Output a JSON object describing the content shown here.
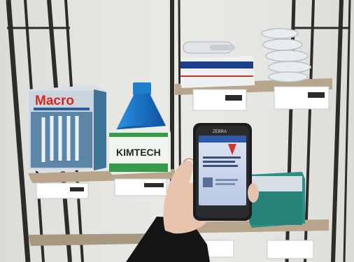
{
  "scene": {
    "kind": "photo",
    "subject": "hand holding a rugged handheld scanner in front of a lab supply shelf"
  },
  "labels": {
    "macro_box": "Macro",
    "kimtech_box": "KIMTECH",
    "phone_brand": "ZEBRA"
  },
  "colors": {
    "wall": "#e6e7e3",
    "shelf_wood": "#b7a68c",
    "metal_frame": "#2f2b28",
    "flask_blue": "#1f7fcf",
    "kimtech_green": "#3a9a4c",
    "teal_box": "#2c8f86",
    "screen_blue": "#2f5aa7",
    "sleeve": "#141515",
    "skin": "#e8c3ad"
  }
}
